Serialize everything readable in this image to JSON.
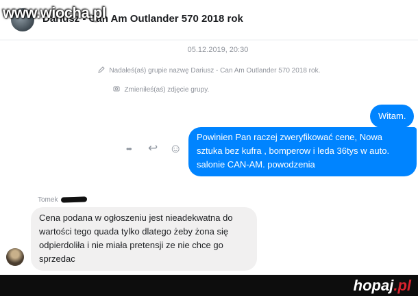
{
  "header": {
    "title": "Dariusz - Can Am Outlander 570 2018 rok",
    "watermark": "www.wiocha.pl"
  },
  "timestamp": "05.12.2019, 20:30",
  "system_messages": [
    {
      "icon": "pencil-icon",
      "text": "Nadałeś(aś) grupie nazwę Dariusz - Can Am Outlander 570 2018 rok."
    },
    {
      "icon": "photo-icon",
      "text": "Zmieniłeś(aś) zdjęcie grupy."
    }
  ],
  "messages": [
    {
      "direction": "outgoing",
      "text": "Witam."
    },
    {
      "direction": "outgoing",
      "text": "Powinien Pan raczej zweryfikować cene, Nowa sztuka bez kufra , bomperow i leda 36tys w auto. salonie CAN-AM. powodzenia"
    },
    {
      "direction": "incoming",
      "sender": "Tomek",
      "text": "Cena podana w ogłoszeniu jest nieadekwatna do wartości tego quada tylko dlatego żeby żona się odpierdoliła i nie miała pretensji ze nie chce go sprzedac"
    }
  ],
  "actions": {
    "more": "•••",
    "reply": "↩",
    "react": "☺"
  },
  "footer": {
    "logo": "hopaj",
    "logo_tld": ".pl"
  },
  "colors": {
    "outgoing_bubble": "#0084ff",
    "incoming_bubble": "#f1f0f0",
    "footer_bg": "#0d0d0d",
    "logo_accent": "#d9232e"
  }
}
